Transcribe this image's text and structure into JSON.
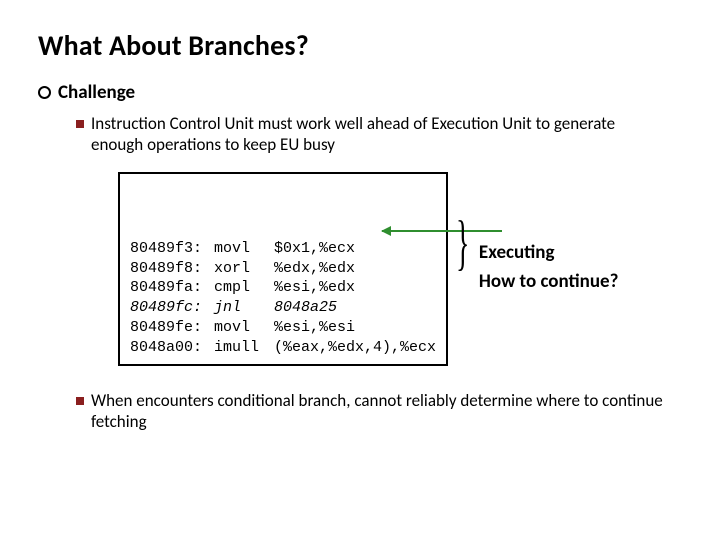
{
  "title": "What About Branches?",
  "l1_heading": "Challenge",
  "bullet1": "Instruction Control Unit must work well ahead of Execution Unit to generate enough operations to keep EU busy",
  "bullet2": "When encounters conditional branch, cannot reliably determine where to continue fetching",
  "code": {
    "rows": [
      {
        "addr": "80489f3:",
        "op": "movl",
        "args": "$0x1,%ecx",
        "italic": false
      },
      {
        "addr": "80489f8:",
        "op": "xorl",
        "args": "%edx,%edx",
        "italic": false
      },
      {
        "addr": "80489fa:",
        "op": "cmpl",
        "args": "%esi,%edx",
        "italic": false
      },
      {
        "addr": "80489fc:",
        "op": "jnl",
        "args": "8048a25",
        "italic": true
      },
      {
        "addr": "80489fe:",
        "op": "movl",
        "args": "%esi,%esi",
        "italic": false
      },
      {
        "addr": "8048a00:",
        "op": "imull",
        "args": "(%eax,%edx,4),%ecx",
        "italic": false
      }
    ]
  },
  "annot1": "Executing",
  "annot2": "How to continue?"
}
